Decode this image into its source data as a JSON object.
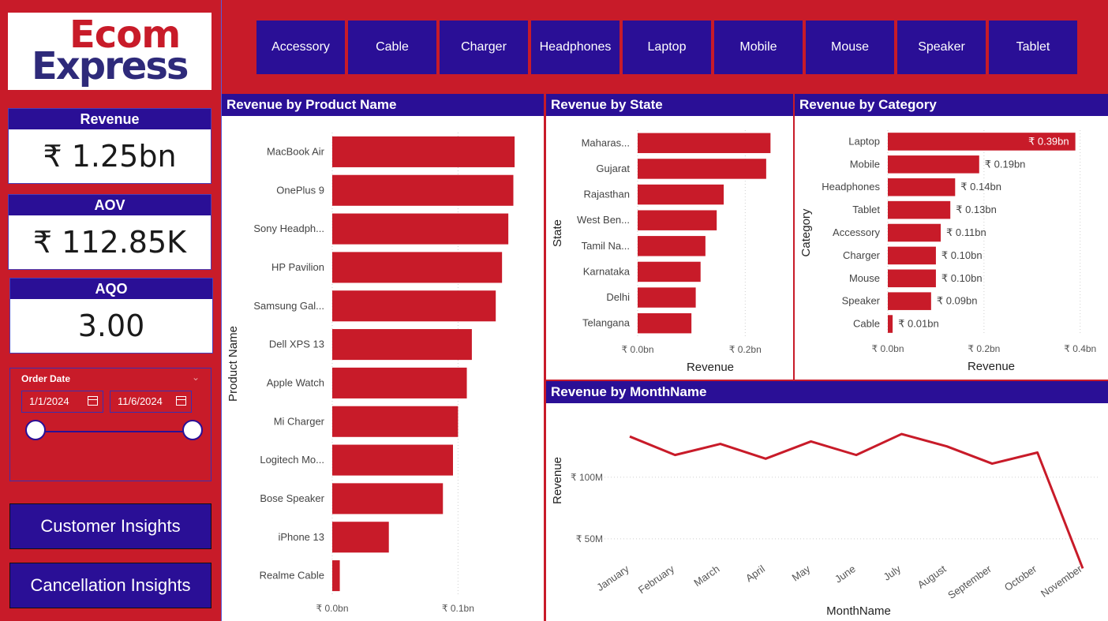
{
  "logo": {
    "line1": "Ecom",
    "line2": "Express"
  },
  "kpis": [
    {
      "label": "Revenue",
      "value": "₹ 1.25bn"
    },
    {
      "label": "AOV",
      "value": "₹ 112.85K"
    },
    {
      "label": "AQO",
      "value": "3.00"
    }
  ],
  "order_date": {
    "label": "Order Date",
    "start": "1/1/2024",
    "end": "11/6/2024"
  },
  "nav": {
    "customer": "Customer Insights",
    "cancellation": "Cancellation Insights"
  },
  "categories": [
    "Accessory",
    "Cable",
    "Charger",
    "Headphones",
    "Laptop",
    "Mobile",
    "Mouse",
    "Speaker",
    "Tablet"
  ],
  "colors": {
    "bar": "#c81b29",
    "header": "#2a0f96",
    "background": "#c81b29"
  },
  "panels": {
    "product": "Revenue by Product Name",
    "state": "Revenue by State",
    "category": "Revenue by Category",
    "month": "Revenue by MonthName"
  },
  "chart_data": [
    {
      "type": "bar",
      "orientation": "horizontal",
      "title": "Revenue by Product Name",
      "xlabel": "Revenue",
      "ylabel": "Product Name",
      "categories": [
        "MacBook Air",
        "OnePlus 9",
        "Sony Headph...",
        "HP Pavilion",
        "Samsung Gal...",
        "Dell XPS 13",
        "Apple Watch",
        "Mi Charger",
        "Logitech Mo...",
        "Bose Speaker",
        "iPhone 13",
        "Realme Cable"
      ],
      "values": [
        0.145,
        0.144,
        0.14,
        0.135,
        0.13,
        0.111,
        0.107,
        0.1,
        0.096,
        0.088,
        0.045,
        0.006
      ],
      "xlim": [
        0,
        0.16
      ],
      "xticks": [
        {
          "v": 0,
          "label": "₹ 0.0bn"
        },
        {
          "v": 0.1,
          "label": "₹ 0.1bn"
        }
      ],
      "grid": true
    },
    {
      "type": "bar",
      "orientation": "horizontal",
      "title": "Revenue by State",
      "xlabel": "Revenue",
      "ylabel": "State",
      "categories": [
        "Maharas...",
        "Gujarat",
        "Rajasthan",
        "West Ben...",
        "Tamil Na...",
        "Karnataka",
        "Delhi",
        "Telangana"
      ],
      "values": [
        0.247,
        0.239,
        0.16,
        0.147,
        0.126,
        0.117,
        0.108,
        0.1
      ],
      "xlim": [
        0,
        0.27
      ],
      "xticks": [
        {
          "v": 0,
          "label": "₹ 0.0bn"
        },
        {
          "v": 0.2,
          "label": "₹ 0.2bn"
        }
      ],
      "grid": true
    },
    {
      "type": "bar",
      "orientation": "horizontal",
      "title": "Revenue by Category",
      "xlabel": "Revenue",
      "ylabel": "Category",
      "categories": [
        "Laptop",
        "Mobile",
        "Headphones",
        "Tablet",
        "Accessory",
        "Charger",
        "Mouse",
        "Speaker",
        "Cable"
      ],
      "values": [
        0.39,
        0.19,
        0.14,
        0.13,
        0.11,
        0.1,
        0.1,
        0.09,
        0.01
      ],
      "labels": [
        "₹ 0.39bn",
        "₹ 0.19bn",
        "₹ 0.14bn",
        "₹ 0.13bn",
        "₹ 0.11bn",
        "₹ 0.10bn",
        "₹ 0.10bn",
        "₹ 0.09bn",
        "₹ 0.01bn"
      ],
      "xlim": [
        0,
        0.43
      ],
      "xticks": [
        {
          "v": 0,
          "label": "₹ 0.0bn"
        },
        {
          "v": 0.2,
          "label": "₹ 0.2bn"
        },
        {
          "v": 0.4,
          "label": "₹ 0.4bn"
        }
      ],
      "grid": true
    },
    {
      "type": "line",
      "title": "Revenue by MonthName",
      "xlabel": "MonthName",
      "ylabel": "Revenue",
      "categories": [
        "January",
        "February",
        "March",
        "April",
        "May",
        "June",
        "July",
        "August",
        "September",
        "October",
        "November"
      ],
      "values": [
        133,
        118,
        127,
        115,
        129,
        118,
        135,
        125,
        111,
        120,
        26
      ],
      "ylim": [
        0,
        160
      ],
      "yticks": [
        {
          "v": 50,
          "label": "₹ 50M"
        },
        {
          "v": 100,
          "label": "₹ 100M"
        }
      ],
      "grid": true
    }
  ]
}
